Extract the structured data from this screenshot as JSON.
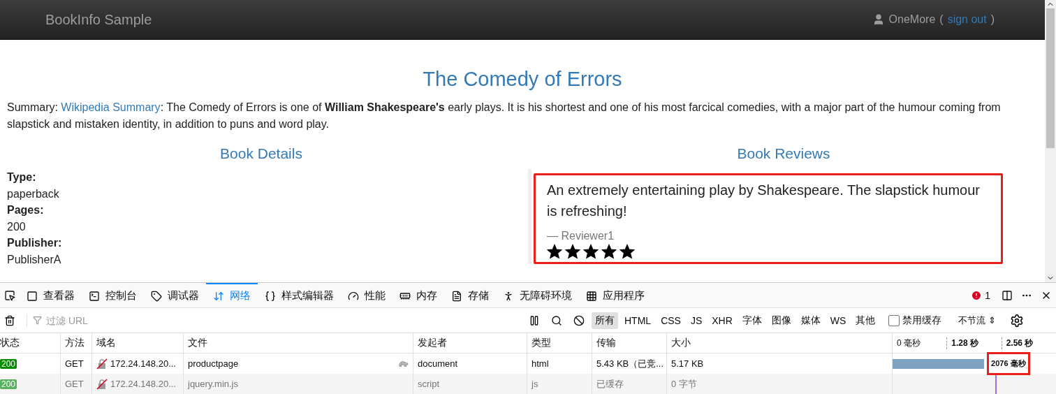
{
  "navbar": {
    "brand": "BookInfo Sample",
    "user": "OneMore",
    "paren_open": "(",
    "sign_out": "sign out",
    "paren_close": ")"
  },
  "book": {
    "title": "The Comedy of Errors",
    "summary_label": "Summary:",
    "summary_link": "Wikipedia Summary",
    "summary_text": ": The Comedy of Errors is one of **William Shakespeare's** early plays. It is his shortest and one of his most farcical comedies, with a major part of the humour coming from slapstick and mistaken identity, in addition to puns and word play."
  },
  "details": {
    "heading": "Book Details",
    "fields": [
      {
        "label": "Type:",
        "value": "paperback"
      },
      {
        "label": "Pages:",
        "value": "200"
      },
      {
        "label": "Publisher:",
        "value": "PublisherA"
      }
    ]
  },
  "reviews": {
    "heading": "Book Reviews",
    "items": [
      {
        "text": "An extremely entertaining play by Shakespeare. The slapstick humour is refreshing!",
        "reviewer": "— Reviewer1",
        "stars": 5,
        "highlighted": true
      }
    ]
  },
  "devtools": {
    "tabs": [
      {
        "label": "查看器",
        "selected": false
      },
      {
        "label": "控制台",
        "selected": false
      },
      {
        "label": "调试器",
        "selected": false
      },
      {
        "label": "网络",
        "selected": true
      },
      {
        "label": "样式编辑器",
        "selected": false
      },
      {
        "label": "性能",
        "selected": false
      },
      {
        "label": "内存",
        "selected": false
      },
      {
        "label": "存储",
        "selected": false
      },
      {
        "label": "无障碍环境",
        "selected": false
      },
      {
        "label": "应用程序",
        "selected": false
      }
    ],
    "error_count": "1",
    "filter": {
      "placeholder": "过滤 URL"
    },
    "type_filters": [
      {
        "label": "所有",
        "selected": true
      },
      {
        "label": "HTML",
        "selected": false
      },
      {
        "label": "CSS",
        "selected": false
      },
      {
        "label": "JS",
        "selected": false
      },
      {
        "label": "XHR",
        "selected": false
      },
      {
        "label": "字体",
        "selected": false
      },
      {
        "label": "图像",
        "selected": false
      },
      {
        "label": "媒体",
        "selected": false
      },
      {
        "label": "WS",
        "selected": false
      },
      {
        "label": "其他",
        "selected": false
      }
    ],
    "disable_cache": {
      "label": "禁用缓存",
      "checked": false
    },
    "throttle": "不节流 ⇕",
    "columns": [
      "状态",
      "方法",
      "域名",
      "文件",
      "发起者",
      "类型",
      "传输",
      "大小"
    ],
    "timeline_ticks": [
      "0 毫秒",
      "1.28 秒",
      "2.56 秒"
    ],
    "rows": [
      {
        "status": "200",
        "method": "GET",
        "domain": "172.24.148.20...",
        "file": "productpage",
        "slow": true,
        "initiator": "document",
        "type": "html",
        "transfer": "5.43 KB（已竞...",
        "size": "5.17 KB",
        "cached": false,
        "level": 0.56,
        "timing": "2076 毫秒",
        "highlighted": true
      },
      {
        "status": "200",
        "method": "GET",
        "domain": "172.24.148.20...",
        "file": "jquery.min.js",
        "slow": false,
        "initiator": "script",
        "type": "js",
        "transfer": "已缓存",
        "size": "0 字节",
        "cached": true
      }
    ]
  }
}
